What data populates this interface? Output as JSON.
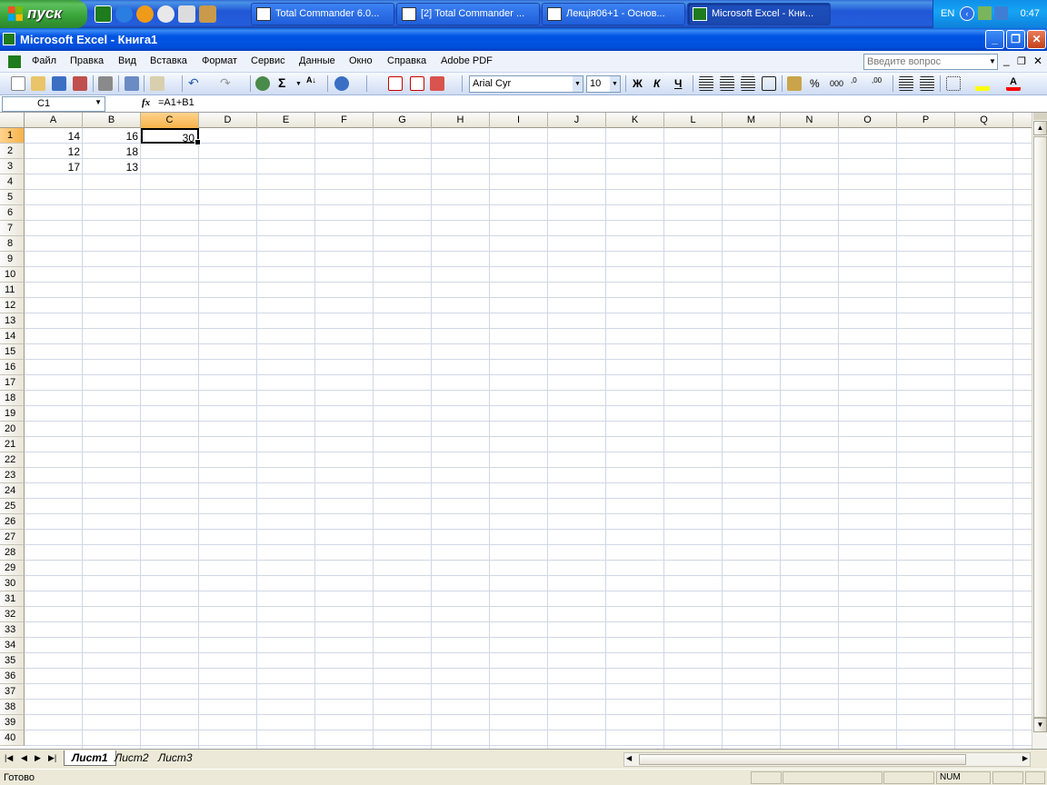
{
  "taskbar": {
    "start_label": "пуск",
    "quicklaunch_icons": [
      "excel-icon",
      "ie-icon",
      "media-player-icon",
      "chrome-icon",
      "notepad-icon",
      "tool-icon"
    ],
    "buttons": [
      {
        "label": "Total Commander 6.0...",
        "icon": "total-commander-icon"
      },
      {
        "label": "[2] Total Commander ...",
        "icon": "total-commander-icon"
      },
      {
        "label": "Лекція06+1 - Основ...",
        "icon": "word-icon"
      },
      {
        "label": "Microsoft Excel - Кни...",
        "icon": "excel-icon",
        "active": true
      }
    ],
    "lang": "EN",
    "clock": "0:47"
  },
  "window": {
    "title": "Microsoft Excel - Книга1"
  },
  "menu": {
    "items": [
      "Файл",
      "Правка",
      "Вид",
      "Вставка",
      "Формат",
      "Сервис",
      "Данные",
      "Окно",
      "Справка",
      "Adobe PDF"
    ],
    "ask_placeholder": "Введите вопрос"
  },
  "toolbar": {
    "font_name": "Arial Cyr",
    "font_size": "10",
    "bold_label": "Ж",
    "italic_label": "К",
    "underline_label": "Ч",
    "sum_label": "Σ",
    "percent_label": "%",
    "thousands_label": "000"
  },
  "formula_bar": {
    "name_box": "C1",
    "fx_label": "fx",
    "formula": "=A1+B1"
  },
  "sheet": {
    "columns": [
      "A",
      "B",
      "C",
      "D",
      "E",
      "F",
      "G",
      "H",
      "I",
      "J",
      "K",
      "L",
      "M",
      "N",
      "O",
      "P",
      "Q"
    ],
    "selected_column": "C",
    "rows": [
      "1",
      "2",
      "3",
      "4",
      "5",
      "6",
      "7",
      "8",
      "9",
      "10",
      "11",
      "12",
      "13",
      "14",
      "15",
      "16",
      "17",
      "18",
      "19",
      "20",
      "21",
      "22",
      "23",
      "24",
      "25",
      "26",
      "27",
      "28",
      "29",
      "30",
      "31",
      "32",
      "33",
      "34",
      "35",
      "36",
      "37",
      "38",
      "39",
      "40"
    ],
    "selected_row": "1",
    "cells": {
      "A1": "14",
      "B1": "16",
      "C1": "30",
      "A2": "12",
      "B2": "18",
      "A3": "17",
      "B3": "13"
    },
    "active_cell": "C1"
  },
  "tabs": {
    "items": [
      "Лист1",
      "Лист2",
      "Лист3"
    ],
    "active": "Лист1"
  },
  "status": {
    "text": "Готово",
    "num": "NUM"
  }
}
